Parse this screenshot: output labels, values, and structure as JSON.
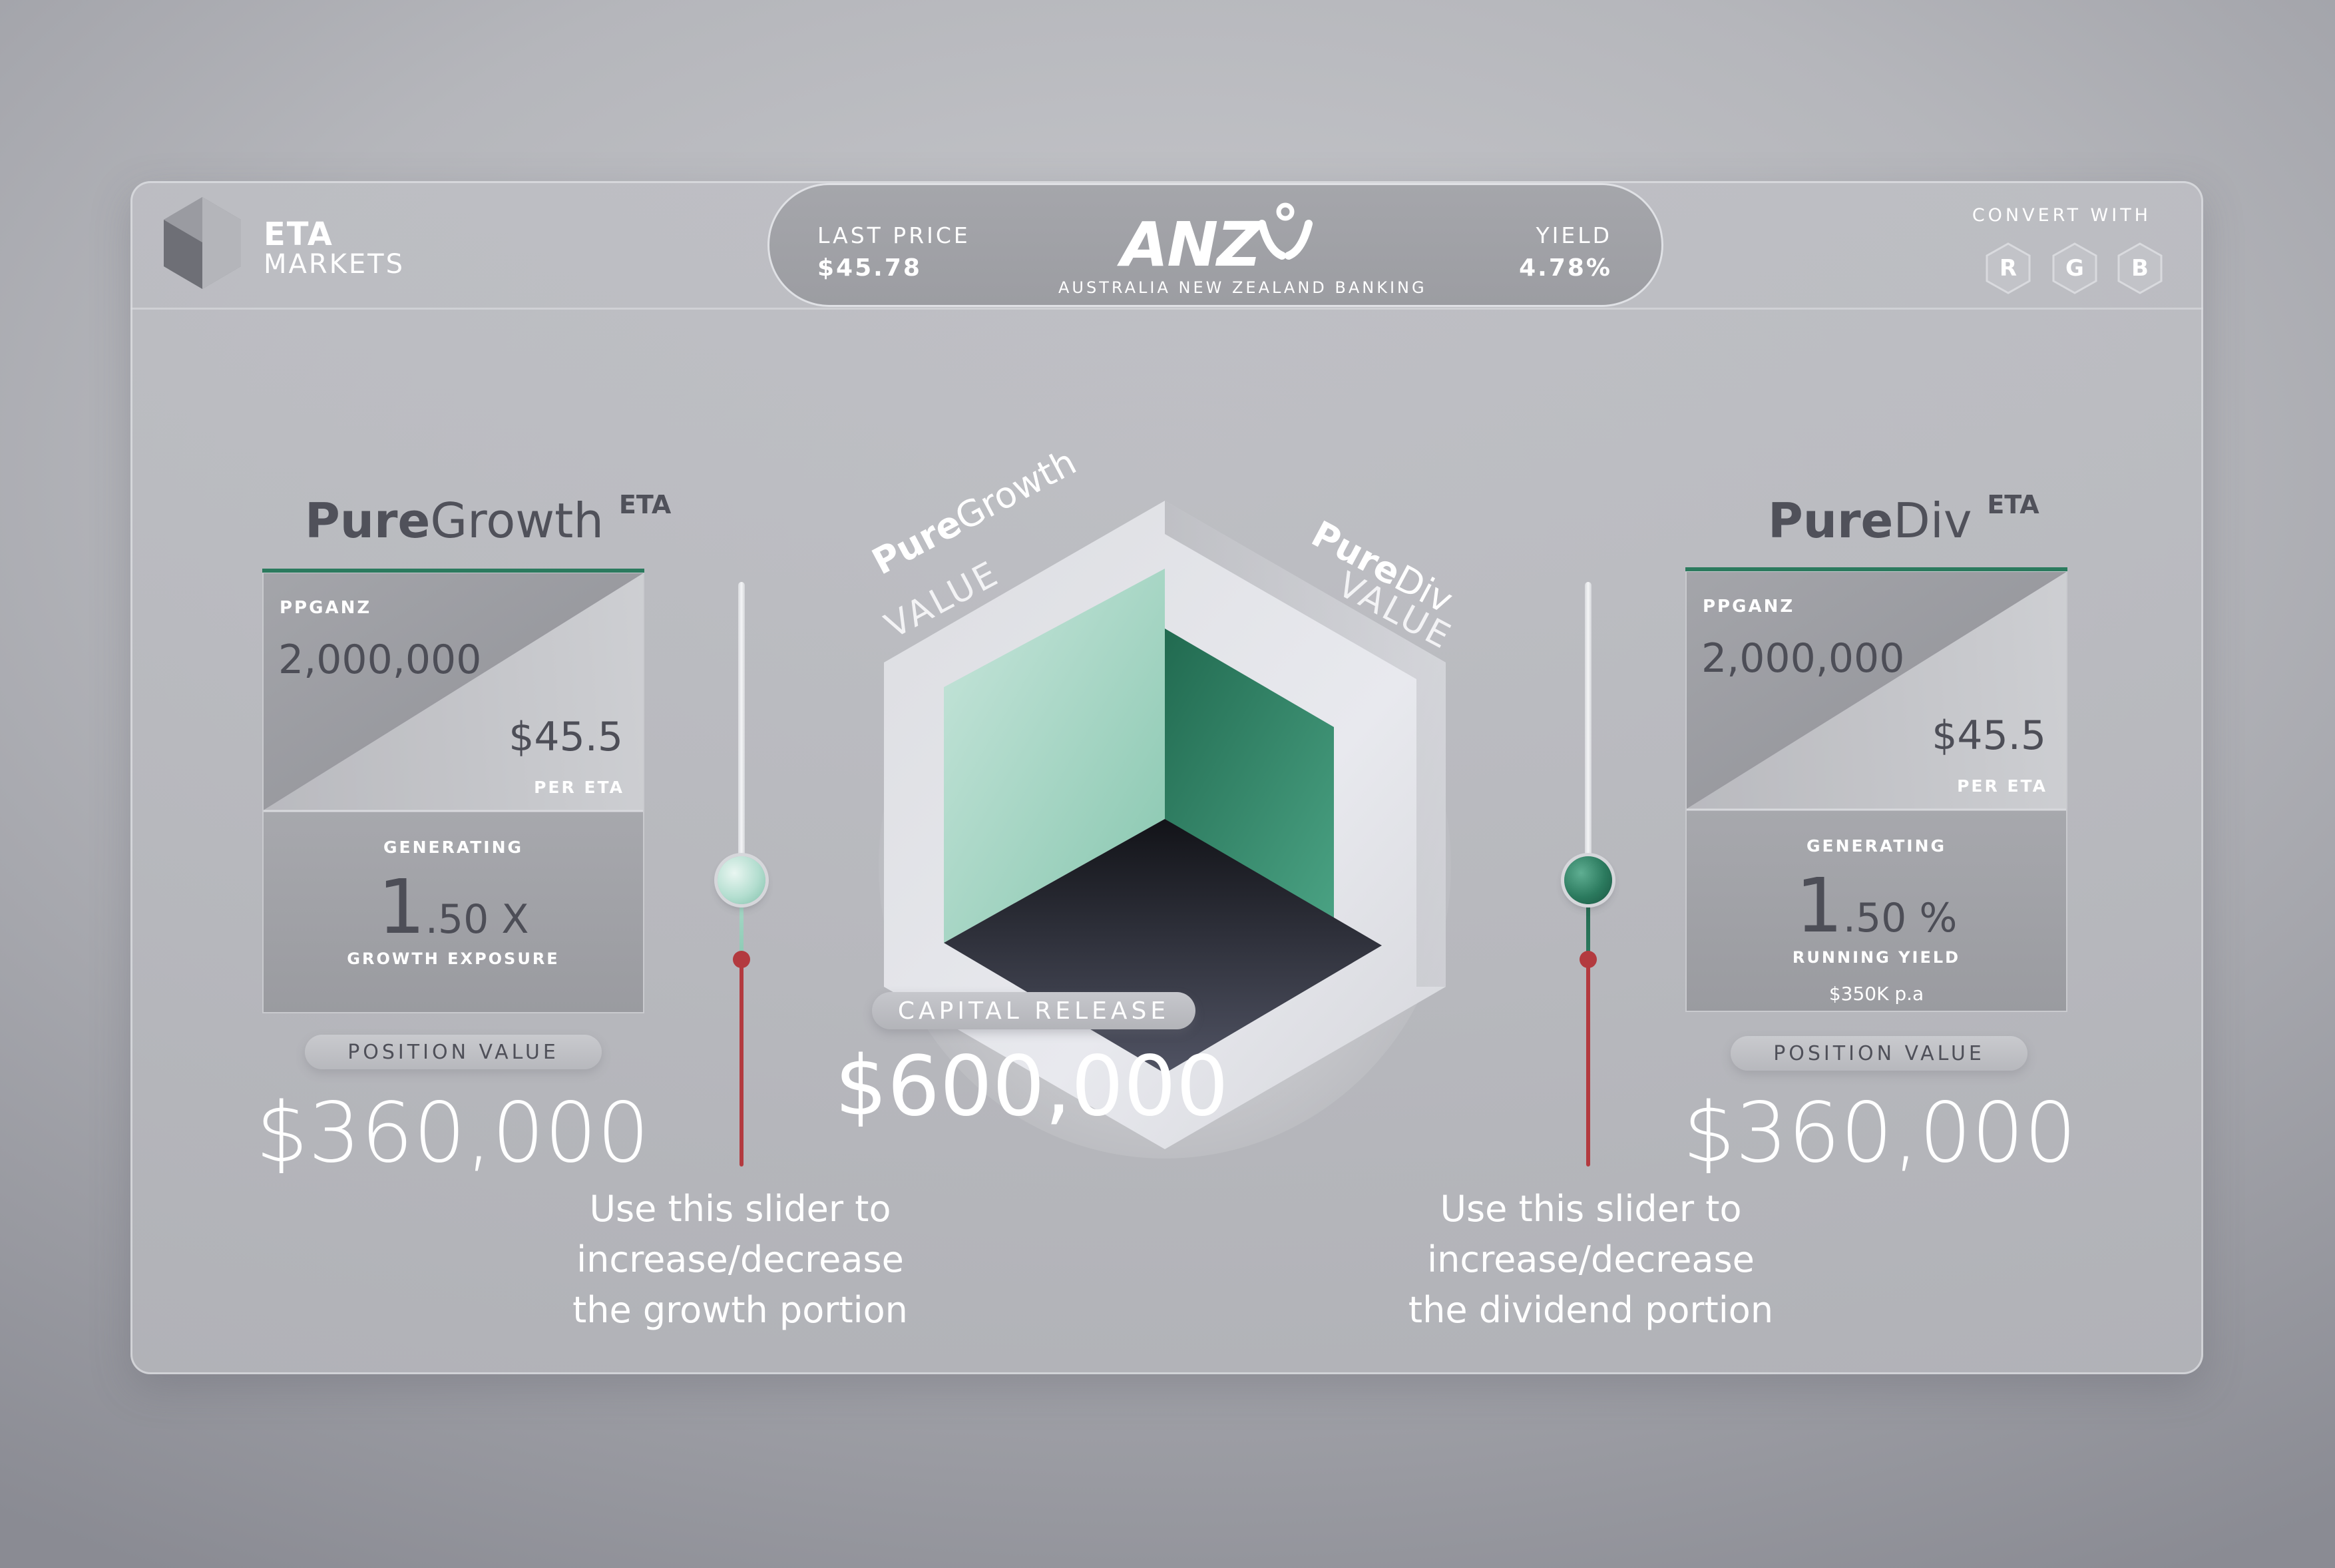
{
  "brand": {
    "name_line1": "ETA",
    "name_line2": "MARKETS"
  },
  "ticker": {
    "last_price_label": "LAST PRICE",
    "last_price_value": "$45.78",
    "company_logo_text": "ANZ",
    "company_full_name": "AUSTRALIA NEW ZEALAND BANKING",
    "yield_label": "YIELD",
    "yield_value": "4.78%"
  },
  "convert": {
    "label": "CONVERT WITH",
    "buttons": [
      "R",
      "G",
      "B"
    ]
  },
  "growth": {
    "title_bold": "Pure",
    "title_light": "Growth",
    "title_sup": "ETA",
    "code": "PPGANZ",
    "units": "2,000,000",
    "price": "$45.5",
    "per_label": "PER ETA",
    "generating_label": "GENERATING",
    "multiple_int": "1",
    "multiple_dec": ".50 X",
    "metric_label": "GROWTH EXPOSURE",
    "position_label": "POSITION VALUE",
    "position_value": "$360,000",
    "help_lines": [
      "Use this slider to",
      "increase/decrease",
      "the growth portion"
    ]
  },
  "dividend": {
    "title_bold": "Pure",
    "title_light": "Div",
    "title_sup": "ETA",
    "code": "PPGANZ",
    "units": "2,000,000",
    "price": "$45.5",
    "per_label": "PER ETA",
    "generating_label": "GENERATING",
    "yield_int": "1",
    "yield_dec": ".50 %",
    "metric_label": "RUNNING YIELD",
    "annual_income": "$350K p.a",
    "position_label": "POSITION VALUE",
    "position_value": "$360,000",
    "help_lines": [
      "Use this slider to",
      "increase/decrease",
      "the dividend portion"
    ]
  },
  "cube": {
    "left_label_bold": "Pure",
    "left_label_light": "Growth",
    "left_label_sub": "VALUE",
    "right_label_bold": "Pure",
    "right_label_light": "Div",
    "right_label_sub": "VALUE"
  },
  "capital": {
    "label": "CAPITAL RELEASE",
    "value": "$600,000"
  },
  "sliders": {
    "growth_level": 0.49,
    "dividend_level": 0.49
  },
  "colors": {
    "accent_green": "#2b7a5e",
    "mint": "#9fd4c0",
    "slider_red": "#b33a3f",
    "text_dark": "#4d4e57"
  }
}
